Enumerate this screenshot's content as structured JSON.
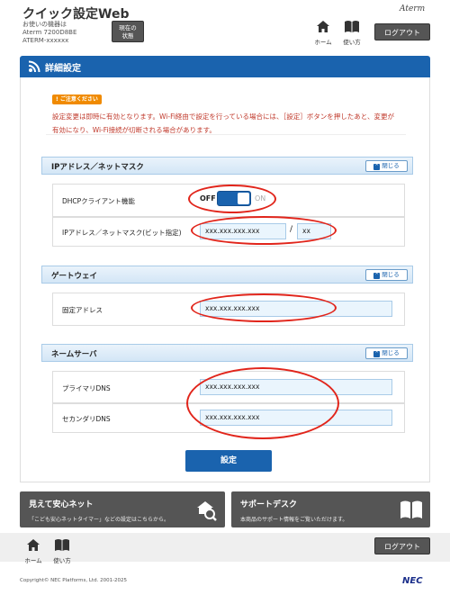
{
  "header": {
    "app_title": "クイック設定Web",
    "device_caption": "お使いの機器は",
    "device_model": "Aterm 7200D8BE",
    "device_name": "ATERM-xxxxxx",
    "status_button_line1": "現在の",
    "status_button_line2": "状態",
    "home_label": "ホーム",
    "howto_label": "使い方",
    "logout_label": "ログアウト",
    "brand": "Aterm"
  },
  "page": {
    "title": "詳細設定",
    "notice_badge": "ご注意ください",
    "notice_text": "設定変更は即時に有効となります。Wi-Fi経由で設定を行っている場合には、［設定］ボタンを押したあと、変更が有効になり、Wi-Fi接続が切断される場合があります。"
  },
  "sections": {
    "ip": {
      "title": "IPアドレス／ネットマスク",
      "close_label": "閉じる",
      "dhcp_label": "DHCPクライアント機能",
      "toggle_off": "OFF",
      "toggle_on": "ON",
      "ip_label": "IPアドレス／ネットマスク(ビット指定)",
      "ip_value": "xxx.xxx.xxx.xxx",
      "slash": "/",
      "mask_value": "xx"
    },
    "gateway": {
      "title": "ゲートウェイ",
      "close_label": "閉じる",
      "fixed_label": "固定アドレス",
      "fixed_value": "xxx.xxx.xxx.xxx"
    },
    "dns": {
      "title": "ネームサーバ",
      "close_label": "閉じる",
      "primary_label": "プライマリDNS",
      "primary_value": "xxx.xxx.xxx.xxx",
      "secondary_label": "セカンダリDNS",
      "secondary_value": "xxx.xxx.xxx.xxx"
    }
  },
  "set_button": "設定",
  "banners": {
    "left_title": "見えて安心ネット",
    "left_text": "「こども安心ネットタイマー」などの設定はこちらから。",
    "right_title": "サポートデスク",
    "right_text": "本商品のサポート情報をご覧いただけます。"
  },
  "footer": {
    "home_label": "ホーム",
    "howto_label": "使い方",
    "logout_label": "ログアウト",
    "copyright": "Copyright© NEC Platforms, Ltd. 2001-2025",
    "nec": "NEC"
  },
  "colors": {
    "primary_blue": "#1a63ae",
    "highlight_red": "#e1251b",
    "notice_orange": "#f08a00"
  }
}
